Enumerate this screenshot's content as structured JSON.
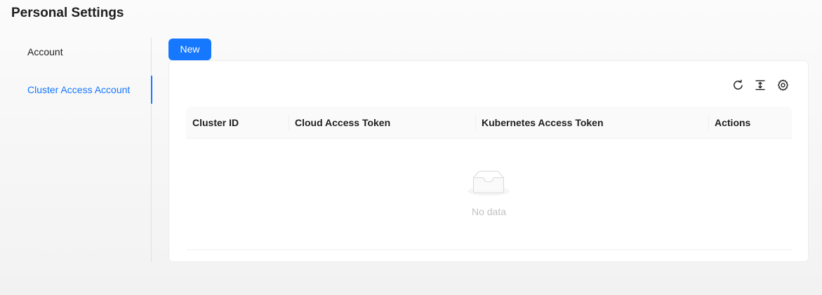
{
  "page": {
    "title": "Personal Settings"
  },
  "sidebar": {
    "items": [
      {
        "label": "Account",
        "active": false
      },
      {
        "label": "Cluster Access Account",
        "active": true
      }
    ]
  },
  "toolbar": {
    "new_label": "New",
    "icons": [
      "reload-icon",
      "column-height-icon",
      "settings-icon"
    ]
  },
  "table": {
    "columns": [
      "Cluster ID",
      "Cloud Access Token",
      "Kubernetes Access Token",
      "Actions"
    ],
    "rows": [],
    "empty_text": "No data"
  },
  "colors": {
    "accent": "#1677ff",
    "background": "#f5f5f5",
    "card": "#ffffff"
  }
}
